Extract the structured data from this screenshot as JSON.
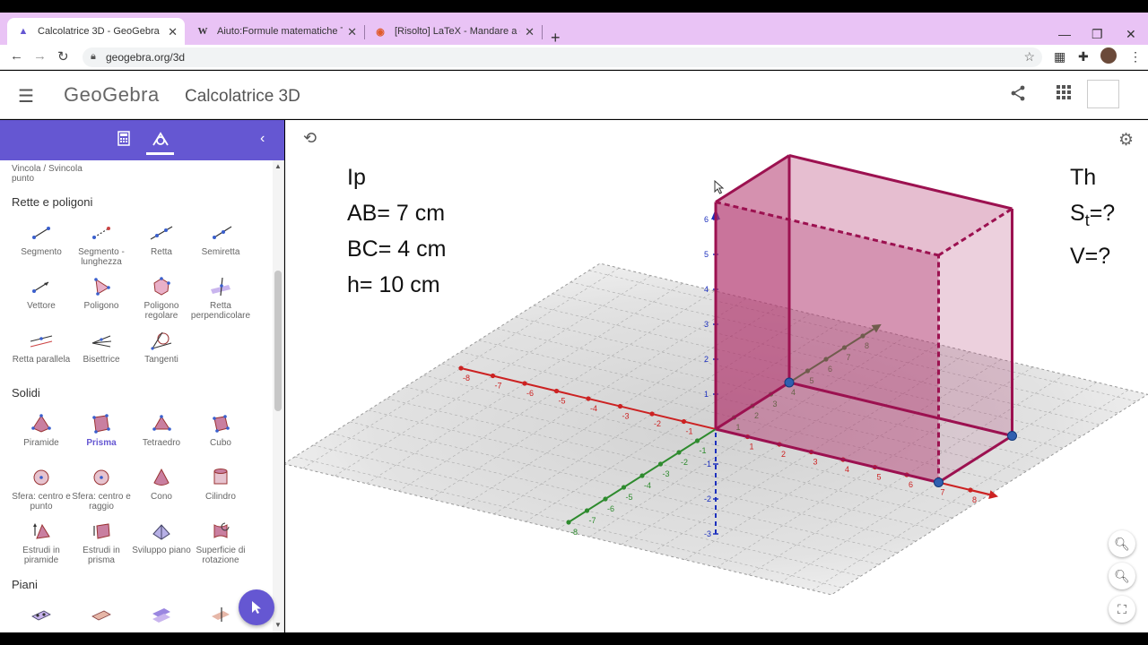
{
  "browser": {
    "tabs": [
      {
        "title": "Calcolatrice 3D - GeoGebra",
        "icon": "geogebra-icon"
      },
      {
        "title": "Aiuto:Formule matematiche TeX",
        "icon": "wikipedia-icon"
      },
      {
        "title": "[Risolto] LaTeX - Mandare a capo",
        "icon": "ubuntu-icon"
      }
    ],
    "tab_favicons": [
      "▲",
      "W",
      "◉"
    ],
    "url": "geogebra.org/3d"
  },
  "app": {
    "logo": "GeoGebra",
    "title": "Calcolatrice 3D"
  },
  "sidebar": {
    "partial_tool": "Vincola / Svincola punto",
    "sections": [
      {
        "title": "Rette e poligoni",
        "tools": [
          "Segmento",
          "Segmento - lunghezza",
          "Retta",
          "Semiretta",
          "Vettore",
          "Poligono",
          "Poligono regolare",
          "Retta perpendicolare",
          "Retta parallela",
          "Bisettrice",
          "Tangenti"
        ]
      },
      {
        "title": "Solidi",
        "tools": [
          "Piramide",
          "Prisma",
          "Tetraedro",
          "Cubo",
          "Sfera: centro e punto",
          "Sfera: centro e raggio",
          "Cono",
          "Cilindro",
          "Estrudi in piramide",
          "Estrudi in prisma",
          "Sviluppo piano",
          "Superficie di rotazione"
        ]
      },
      {
        "title": "Piani",
        "tools": []
      }
    ],
    "selected_tool": "Prisma"
  },
  "canvas": {
    "text_left": [
      "Ip",
      "AB= 7 cm",
      "BC= 4 cm",
      "h= 10 cm"
    ],
    "text_right": {
      "line1": "Th",
      "s_main": "S",
      "s_sub": "t",
      "s_rest": "=?",
      "line3": "V=?"
    },
    "x_axis_ticks": [
      "-8",
      "-7",
      "-6",
      "-5",
      "-4",
      "-3",
      "-2",
      "-1",
      "1",
      "2",
      "3",
      "4",
      "5",
      "6",
      "7",
      "8"
    ],
    "y_axis_ticks": [
      "-8",
      "-7",
      "-6",
      "-5",
      "-4",
      "-3",
      "-2",
      "-1",
      "1",
      "2",
      "3",
      "4",
      "5",
      "6",
      "7",
      "8"
    ],
    "z_axis_ticks": [
      "-3",
      "-2",
      "-1",
      "1",
      "2",
      "3",
      "4",
      "5",
      "6"
    ],
    "prism_fill": "#b0306a",
    "prism_edge": "#9c1150",
    "x_axis_color": "#cc2222",
    "y_axis_color": "#2e8b2e",
    "z_axis_color": "#1b2fbd",
    "accent": "#6557d2"
  }
}
